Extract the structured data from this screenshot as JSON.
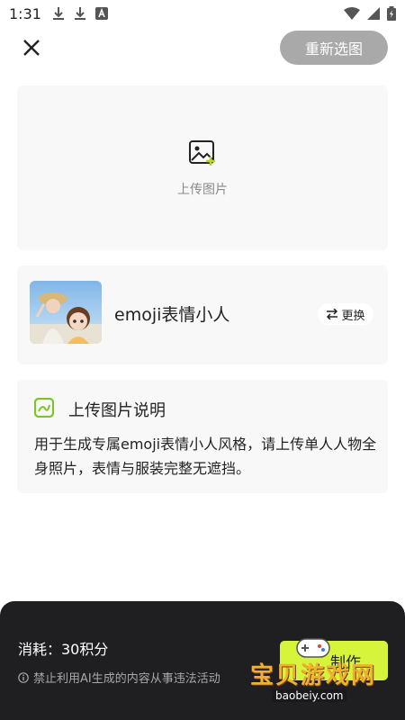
{
  "status": {
    "time": "1:31"
  },
  "header": {
    "reselect_label": "重新选图"
  },
  "upload": {
    "label": "上传图片"
  },
  "style": {
    "name": "emoji表情小人",
    "change_label": "更换"
  },
  "instructions": {
    "title": "上传图片说明",
    "body": "用于生成专属emoji表情小人风格，请上传单人人物全身照片，表情与服装完整无遮挡。"
  },
  "bottom": {
    "cost": "消耗：30积分",
    "notice": "禁止利用AI生成的内容从事违法活动",
    "make_label": "制作"
  },
  "watermark": {
    "text": "宝贝游戏网",
    "url": "baobeiy.com"
  },
  "colors": {
    "accent": "#d6f53a",
    "icon_green": "#7bc42a",
    "panel": "#1f1f21"
  }
}
